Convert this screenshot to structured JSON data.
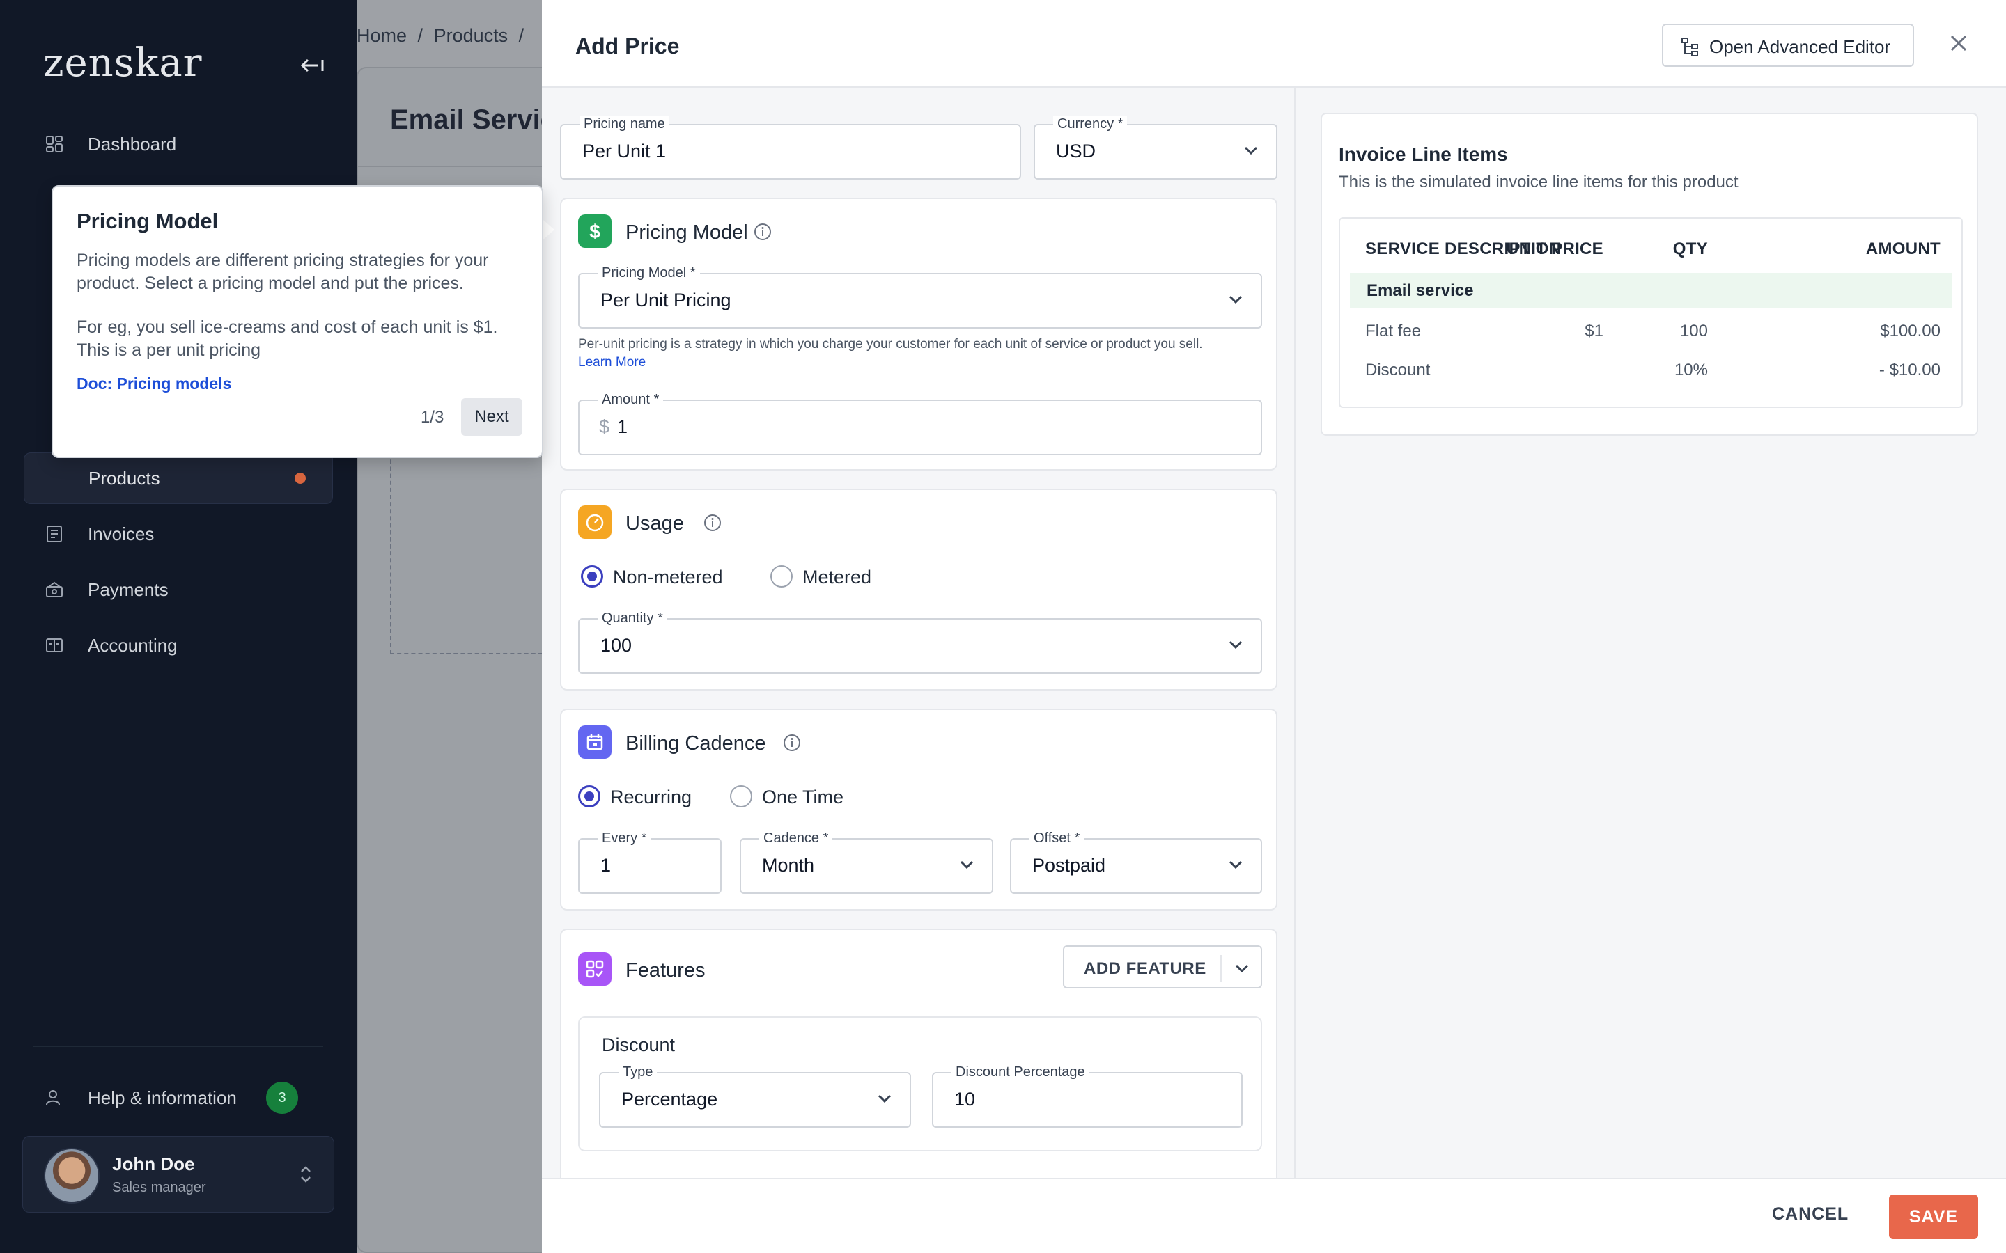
{
  "sidebar": {
    "logo": "zenskar",
    "items": [
      {
        "label": "Dashboard"
      },
      {
        "label": "Products"
      },
      {
        "label": "Invoices"
      },
      {
        "label": "Payments"
      },
      {
        "label": "Accounting"
      }
    ],
    "help": {
      "label": "Help & information",
      "count": "3"
    },
    "user": {
      "name": "John Doe",
      "role": "Sales manager"
    }
  },
  "background": {
    "breadcrumb": [
      "Home",
      "/",
      "Products",
      "/"
    ],
    "page_title": "Email Servic"
  },
  "drawer": {
    "title": "Add Price",
    "advanced_editor_label": "Open Advanced Editor",
    "pricing_name": {
      "label": "Pricing name",
      "value": "Per Unit 1"
    },
    "currency": {
      "label": "Currency *",
      "value": "USD"
    },
    "pricing_model_section": {
      "title": "Pricing Model",
      "select_label": "Pricing Model *",
      "select_value": "Per Unit Pricing",
      "help_text": "Per-unit pricing is a strategy in which you charge your customer for each unit of service or product you sell.",
      "learn_more": "Learn More",
      "amount_label": "Amount *",
      "amount_prefix": "$",
      "amount_value": "1"
    },
    "usage_section": {
      "title": "Usage",
      "option_non_metered": "Non-metered",
      "option_metered": "Metered",
      "selected": "Non-metered",
      "quantity_label": "Quantity *",
      "quantity_value": "100"
    },
    "billing_section": {
      "title": "Billing Cadence",
      "option_recurring": "Recurring",
      "option_one_time": "One Time",
      "selected": "Recurring",
      "every_label": "Every *",
      "every_value": "1",
      "cadence_label": "Cadence *",
      "cadence_value": "Month",
      "offset_label": "Offset *",
      "offset_value": "Postpaid"
    },
    "features_section": {
      "title": "Features",
      "add_feature_label": "ADD FEATURE",
      "discount": {
        "title": "Discount",
        "type_label": "Type",
        "type_value": "Percentage",
        "percentage_label": "Discount Percentage",
        "percentage_value": "10"
      }
    },
    "footer": {
      "cancel": "CANCEL",
      "save": "SAVE"
    }
  },
  "invoice": {
    "title": "Invoice Line Items",
    "subtitle": "This is the simulated invoice line items for this product",
    "columns": [
      "SERVICE DESCRIPTION",
      "UNIT PRICE",
      "QTY",
      "AMOUNT"
    ],
    "group": "Email service",
    "rows": [
      {
        "description": "Flat fee",
        "unit_price": "$1",
        "qty": "100",
        "amount": "$100.00"
      },
      {
        "description": "Discount",
        "unit_price": "",
        "qty": "10%",
        "amount": "- $10.00"
      }
    ]
  },
  "tooltip": {
    "title": "Pricing Model",
    "paragraph1": "Pricing models are different pricing strategies for your product. Select a pricing model and put the prices.",
    "paragraph2": "For eg, you sell ice-creams and cost of each unit is $1. This is a per unit pricing",
    "link": "Doc: Pricing models",
    "step": "1/3",
    "next": "Next"
  },
  "colors": {
    "sidebar_bg": "#111827",
    "accent_save": "#e8674b",
    "radio_selected": "#3b3fbf",
    "pricing_icon": "#22a55b",
    "usage_icon": "#f5a623",
    "billing_icon": "#6366f1",
    "features_icon": "#a855f7"
  },
  "icons": [
    "collapse-sidebar-icon",
    "dashboard-icon",
    "invoices-icon",
    "payments-icon",
    "accounting-icon",
    "help-icon",
    "chevron-up-down-icon",
    "tree-icon",
    "close-icon",
    "dollar-icon",
    "gauge-icon",
    "calendar-icon",
    "features-icon",
    "info-icon",
    "chevron-down-icon"
  ]
}
